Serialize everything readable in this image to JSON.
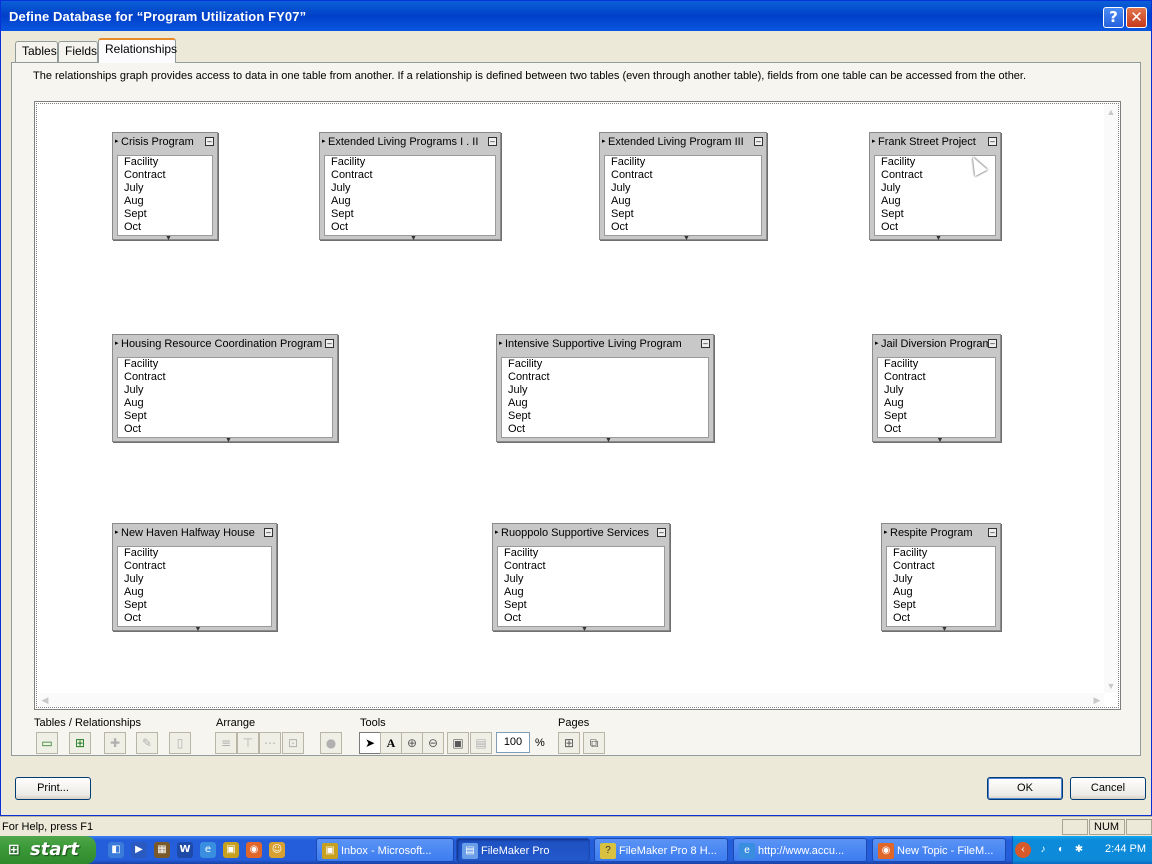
{
  "window": {
    "title": "Define Database for “Program Utilization FY07”",
    "help_icon": "?",
    "close_icon": "✕"
  },
  "tabs": [
    {
      "label": "Tables"
    },
    {
      "label": "Fields"
    },
    {
      "label": "Relationships",
      "selected": true
    }
  ],
  "description": "The relationships graph provides access to data in one table from another. If a relationship is defined between two tables (even through another table), fields from one table can be accessed from the other.",
  "graph": {
    "tables": [
      {
        "name": "Crisis Program",
        "fields": [
          "Facility",
          "Contract",
          "July",
          "Aug",
          "Sept",
          "Oct"
        ]
      },
      {
        "name": "Extended Living Programs I . II",
        "fields": [
          "Facility",
          "Contract",
          "July",
          "Aug",
          "Sept",
          "Oct"
        ]
      },
      {
        "name": "Extended Living Program III",
        "fields": [
          "Facility",
          "Contract",
          "July",
          "Aug",
          "Sept",
          "Oct"
        ]
      },
      {
        "name": "Frank Street Project",
        "fields": [
          "Facility",
          "Contract",
          "July",
          "Aug",
          "Sept",
          "Oct"
        ]
      },
      {
        "name": "Housing Resource Coordination Program",
        "fields": [
          "Facility",
          "Contract",
          "July",
          "Aug",
          "Sept",
          "Oct"
        ]
      },
      {
        "name": "Intensive Supportive Living Program",
        "fields": [
          "Facility",
          "Contract",
          "July",
          "Aug",
          "Sept",
          "Oct"
        ]
      },
      {
        "name": "Jail Diversion Program",
        "fields": [
          "Facility",
          "Contract",
          "July",
          "Aug",
          "Sept",
          "Oct"
        ]
      },
      {
        "name": "New Haven Halfway House",
        "fields": [
          "Facility",
          "Contract",
          "July",
          "Aug",
          "Sept",
          "Oct"
        ]
      },
      {
        "name": "Ruoppolo Supportive Services",
        "fields": [
          "Facility",
          "Contract",
          "July",
          "Aug",
          "Sept",
          "Oct"
        ]
      },
      {
        "name": "Respite Program",
        "fields": [
          "Facility",
          "Contract",
          "July",
          "Aug",
          "Sept",
          "Oct"
        ]
      }
    ]
  },
  "toolbar": {
    "groups": {
      "tables_relationships": "Tables / Relationships",
      "arrange": "Arrange",
      "tools": "Tools",
      "pages": "Pages"
    },
    "zoom": "100",
    "zoom_unit": "%"
  },
  "buttons": {
    "print": "Print...",
    "ok": "OK",
    "cancel": "Cancel"
  },
  "statusbar": {
    "help": "For Help, press F1",
    "num": "NUM"
  },
  "taskbar": {
    "start": "start",
    "tasks": [
      {
        "label": "Inbox - Microsoft...",
        "icon": "outlook-icon",
        "active": false
      },
      {
        "label": "FileMaker Pro",
        "icon": "filemaker-icon",
        "active": true
      },
      {
        "label": "FileMaker Pro 8 H...",
        "icon": "help-file-icon",
        "active": false
      },
      {
        "label": "http://www.accu...",
        "icon": "ie-icon",
        "active": false
      },
      {
        "label": "New Topic - FileM...",
        "icon": "firefox-icon",
        "active": false
      }
    ],
    "clock": "2:44 PM"
  },
  "colors": {
    "titlebar": "#0a5fd8",
    "taskbar": "#245edb",
    "start": "#3c9a39",
    "tray": "#0e8ad9",
    "dialog_bg": "#ece9d8",
    "table_header": "#c8c8c8"
  }
}
